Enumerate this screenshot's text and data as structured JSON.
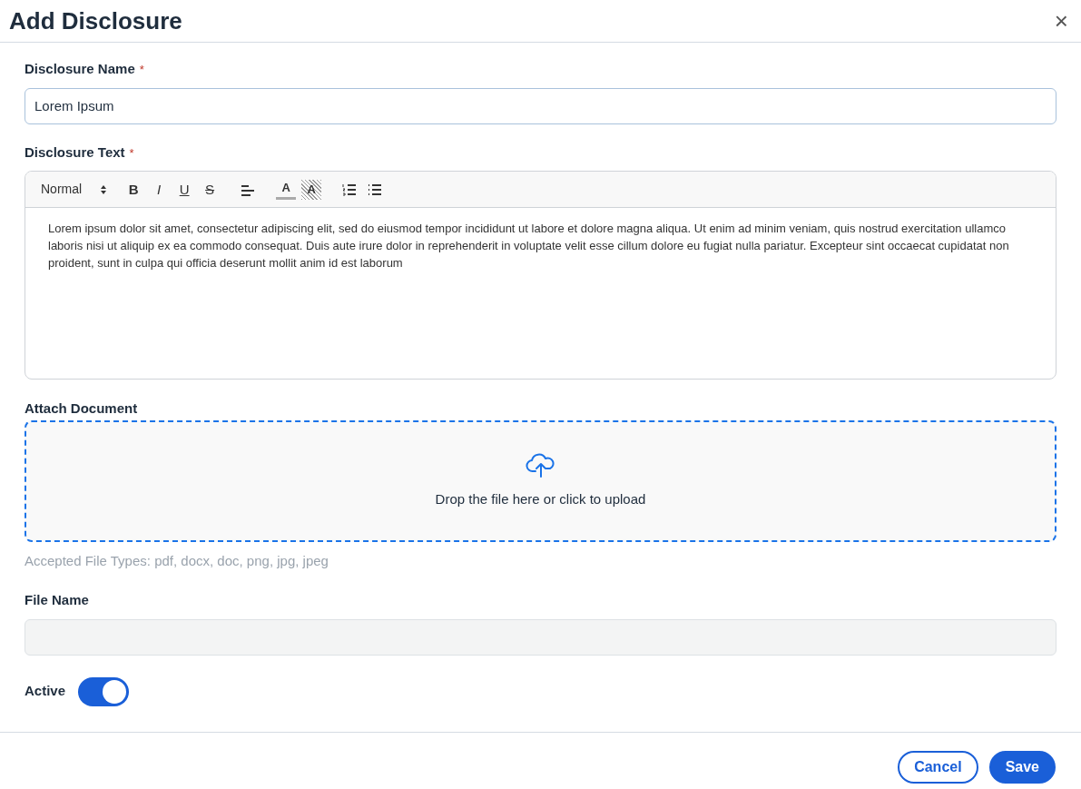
{
  "dialog": {
    "title": "Add Disclosure",
    "close_label": "×"
  },
  "name_field": {
    "label": "Disclosure Name",
    "required_mark": "*",
    "value": "Lorem Ipsum"
  },
  "text_field": {
    "label": "Disclosure Text",
    "required_mark": "*",
    "toolbar": [
      {
        "kind": "select",
        "label": "Normal"
      },
      {
        "kind": "bold",
        "label": "B"
      },
      {
        "kind": "italic",
        "label": "I"
      },
      {
        "kind": "underline",
        "label": "U"
      },
      {
        "kind": "strike",
        "label": "S"
      },
      {
        "kind": "align"
      },
      {
        "kind": "color",
        "label": "A"
      },
      {
        "kind": "background",
        "label": "A"
      },
      {
        "kind": "ordered-list"
      },
      {
        "kind": "bullet-list"
      }
    ],
    "body": "Lorem ipsum dolor sit amet, consectetur adipiscing elit, sed do eiusmod tempor incididunt ut labore et dolore magna aliqua. Ut enim ad minim veniam, quis nostrud exercitation ullamco laboris nisi ut aliquip ex ea commodo consequat. Duis aute irure dolor in reprehenderit in voluptate velit esse cillum dolore eu fugiat nulla pariatur. Excepteur sint occaecat cupidatat non proident, sunt in culpa qui officia deserunt mollit anim id est laborum"
  },
  "attach": {
    "label": "Attach Document",
    "drop_text": "Drop the file here or click to upload",
    "hint": "Accepted File Types: pdf, docx, doc, png, jpg, jpeg"
  },
  "file_name": {
    "label": "File Name",
    "disabled": true
  },
  "active": {
    "label": "Active",
    "on": true
  },
  "buttons": [
    {
      "kind": "secondary",
      "label": "Cancel"
    },
    {
      "kind": "primary",
      "label": "Save"
    }
  ]
}
